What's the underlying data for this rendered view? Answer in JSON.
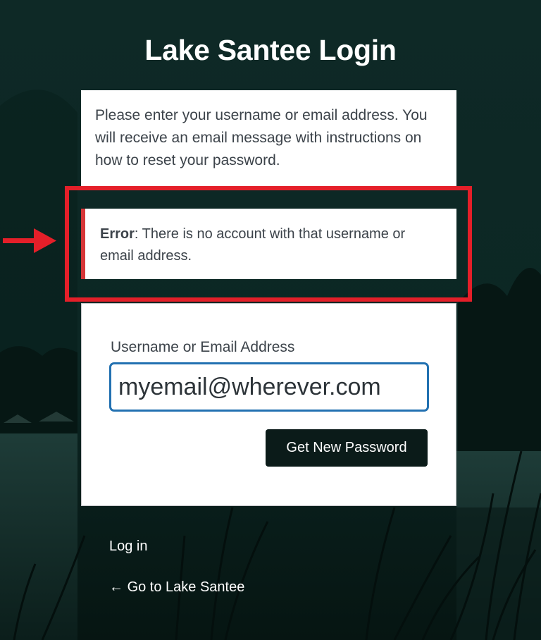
{
  "page": {
    "title": "Lake Santee Login"
  },
  "message": {
    "text": "Please enter your username or email address. You will receive an email message with instructions on how to reset your password."
  },
  "error": {
    "label": "Error",
    "text": ": There is no account with that username or email address.",
    "accent_color": "#d63638"
  },
  "annotation": {
    "highlight_color": "#e41f29"
  },
  "form": {
    "field_label": "Username or Email Address",
    "field_value": "myemail@wherever.com",
    "submit_label": "Get New Password"
  },
  "links": {
    "login": "Log in",
    "back_arrow": "←",
    "back_text": "Go to Lake Santee"
  },
  "icons": {
    "annotation_arrow": "arrow-right-icon",
    "back_arrow": "arrow-left-icon"
  },
  "colors": {
    "background": "#0b2320",
    "button": "#0b1b19",
    "focus": "#2271b1"
  }
}
